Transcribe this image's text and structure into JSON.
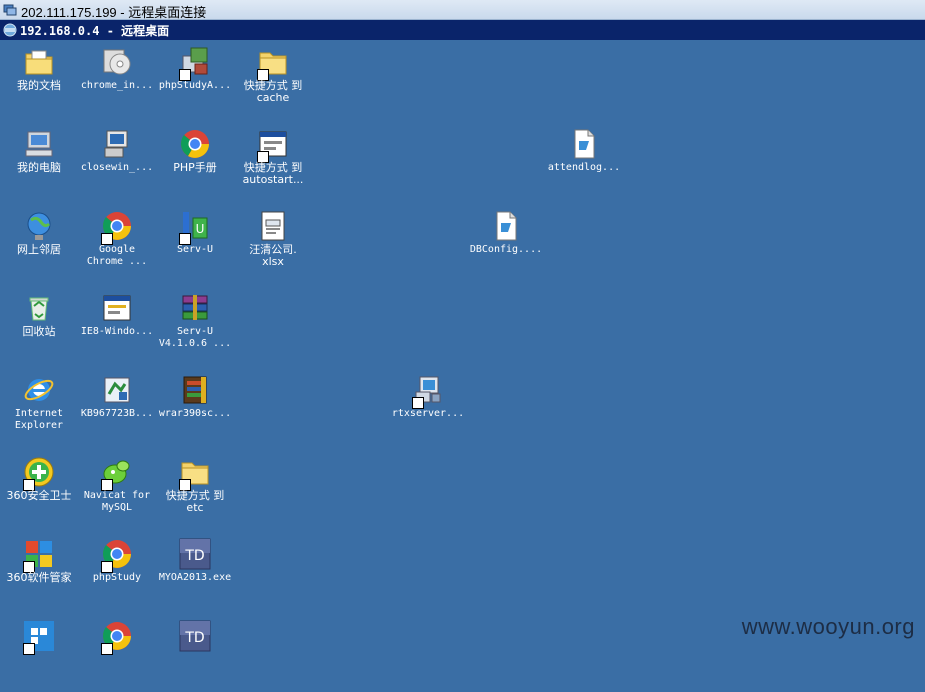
{
  "outer_window": {
    "title": "202.111.175.199 - 远程桌面连接"
  },
  "rdp_bar": {
    "title": "192.168.0.4 - 远程桌面"
  },
  "icons": [
    {
      "label": "我的文档",
      "icon": "folder-documents-icon"
    },
    {
      "label": "chrome_in...",
      "icon": "installer-cd-icon"
    },
    {
      "label": "phpStudyA...",
      "icon": "app-installer-icon"
    },
    {
      "label": "快捷方式 到\ncache",
      "icon": "folder-icon"
    },
    {
      "label": "我的电脑",
      "icon": "computer-icon"
    },
    {
      "label": "closewin_...",
      "icon": "setup-icon"
    },
    {
      "label": "PHP手册",
      "icon": "chrome-icon"
    },
    {
      "label": "快捷方式 到\nautostart...",
      "icon": "window-icon"
    },
    {
      "label": "attendlog...",
      "icon": "document-icon"
    },
    {
      "label": "网上邻居",
      "icon": "network-icon"
    },
    {
      "label": "Google\nChrome ...",
      "icon": "chrome-icon"
    },
    {
      "label": "Serv-U",
      "icon": "servu-icon"
    },
    {
      "label": "汪清公司.\nxlsx",
      "icon": "spreadsheet-icon"
    },
    {
      "label": "DBConfig....",
      "icon": "document-icon"
    },
    {
      "label": "回收站",
      "icon": "recycle-bin-icon"
    },
    {
      "label": "IE8-Windo...",
      "icon": "window-icon"
    },
    {
      "label": "Serv-U\nV4.1.0.6 ...",
      "icon": "winrar-icon"
    },
    {
      "label": "Internet\nExplorer",
      "icon": "ie-icon"
    },
    {
      "label": "KB967723B...",
      "icon": "update-icon"
    },
    {
      "label": "wrar390sc...",
      "icon": "winrar-setup-icon"
    },
    {
      "label": "rtxserver...",
      "icon": "rtx-icon"
    },
    {
      "label": "360安全卫士",
      "icon": "360-safe-icon"
    },
    {
      "label": "Navicat for\nMySQL",
      "icon": "navicat-icon"
    },
    {
      "label": "快捷方式 到\netc",
      "icon": "folder-icon"
    },
    {
      "label": "360软件管家",
      "icon": "360-soft-icon"
    },
    {
      "label": "phpStudy",
      "icon": "chrome-icon"
    },
    {
      "label": "MYOA2013.exe",
      "icon": "td-icon"
    },
    {
      "label": "",
      "icon": "blue-squares-icon"
    },
    {
      "label": "",
      "icon": "chrome-icon"
    },
    {
      "label": "",
      "icon": "td-icon"
    }
  ],
  "watermark": "www.wooyun.org",
  "colors": {
    "desktop": "#3a6ea5",
    "rdp_bar": "#0a246a",
    "label_text": "#ffffff"
  }
}
